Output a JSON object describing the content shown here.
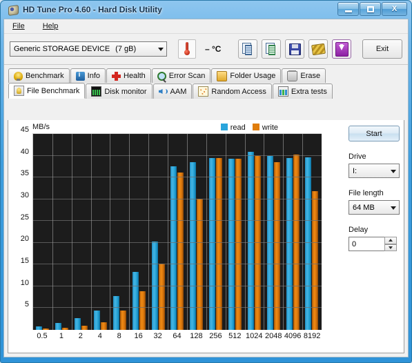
{
  "window": {
    "title": "HD Tune Pro 4.60 - Hard Disk Utility",
    "icon": "hdtune-disc-icon",
    "controls": {
      "minimize": "minimize-button",
      "maximize": "maximize-button",
      "close_label": "X"
    }
  },
  "menu": {
    "items": [
      {
        "label": "File"
      },
      {
        "label": "Help"
      }
    ]
  },
  "toolbar": {
    "device": {
      "value": "Generic STORAGE DEVICE",
      "size": "(7 gB)"
    },
    "temperature": "– °C",
    "buttons": [
      {
        "name": "copy-text-button",
        "icon": "copy-text-icon"
      },
      {
        "name": "copy-image-button",
        "icon": "copy-image-icon"
      },
      {
        "name": "save-button",
        "icon": "floppy-save-icon"
      },
      {
        "name": "gold-button",
        "icon": "gold-bar-icon"
      },
      {
        "name": "download-button",
        "icon": "download-arrow-icon"
      }
    ],
    "exit_label": "Exit"
  },
  "tabs": {
    "row1": [
      {
        "label": "Benchmark",
        "icon": "lightbulb-icon",
        "active": false
      },
      {
        "label": "Info",
        "icon": "info-icon",
        "active": false
      },
      {
        "label": "Health",
        "icon": "red-cross-icon",
        "active": false
      },
      {
        "label": "Error Scan",
        "icon": "magnifier-icon",
        "active": false
      },
      {
        "label": "Folder Usage",
        "icon": "folder-icon",
        "active": false
      },
      {
        "label": "Erase",
        "icon": "trash-icon",
        "active": false
      }
    ],
    "row2": [
      {
        "label": "File Benchmark",
        "icon": "file-benchmark-icon",
        "active": true
      },
      {
        "label": "Disk monitor",
        "icon": "monitor-graph-icon",
        "active": false
      },
      {
        "label": "AAM",
        "icon": "speaker-icon",
        "active": false
      },
      {
        "label": "Random Access",
        "icon": "random-dots-icon",
        "active": false
      },
      {
        "label": "Extra tests",
        "icon": "extra-tests-icon",
        "active": false
      }
    ]
  },
  "side_panel": {
    "start_label": "Start",
    "drive_label": "Drive",
    "drive_value": "I:",
    "file_length_label": "File length",
    "file_length_value": "64 MB",
    "delay_label": "Delay",
    "delay_value": "0"
  },
  "colors": {
    "read": "#2aa5dc",
    "write": "#e07d0c",
    "plot_bg": "#1c1c1c",
    "accent": "#3e9ddd"
  },
  "chart_data": {
    "type": "bar",
    "title": "",
    "ylabel": "MB/s",
    "xlabel": "",
    "ylim": [
      0,
      45
    ],
    "yticks": [
      0,
      5,
      10,
      15,
      20,
      25,
      30,
      35,
      40,
      45
    ],
    "ytick_labels": [
      "",
      "5",
      "10",
      "15",
      "20",
      "25",
      "30",
      "35",
      "40",
      "45"
    ],
    "grid": true,
    "legend_position": "top-right",
    "categories": [
      "0.5",
      "1",
      "2",
      "4",
      "8",
      "16",
      "32",
      "64",
      "128",
      "256",
      "512",
      "1024",
      "2048",
      "4096",
      "8192"
    ],
    "series": [
      {
        "name": "read",
        "color": "#2aa5dc",
        "values": [
          0.8,
          1.6,
          2.7,
          4.4,
          7.8,
          13.3,
          20.3,
          37.6,
          38.5,
          39.5,
          39.3,
          40.9,
          40.0,
          39.5,
          39.6
        ]
      },
      {
        "name": "write",
        "color": "#e07d0c",
        "values": [
          0.3,
          0.4,
          0.9,
          1.7,
          4.5,
          8.8,
          15.2,
          36.1,
          30.1,
          39.4,
          39.3,
          39.9,
          38.5,
          40.2,
          31.8
        ]
      }
    ]
  }
}
